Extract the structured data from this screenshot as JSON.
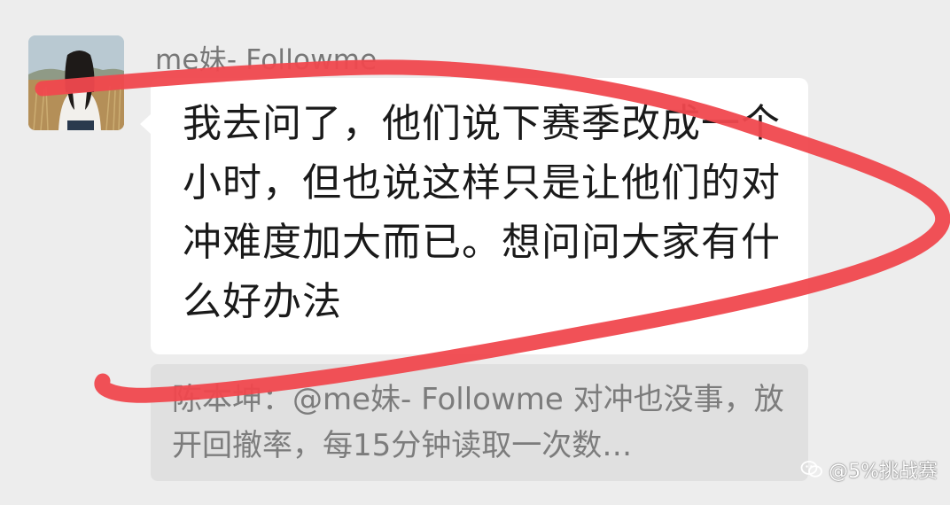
{
  "message": {
    "sender_name": "me妹- Followme",
    "text": "我去问了，他们说下赛季改成一个小时，但也说这样只是让他们的对冲难度加大而已。想问问大家有什么好办法"
  },
  "quoted_reply": {
    "text": "陈本坤：@me妹- Followme 对冲也没事，放开回撤率，每15分钟读取一次数…"
  },
  "avatar": {
    "icon": "user-avatar-photo"
  },
  "watermark": {
    "text": "@5%挑战赛",
    "icon": "wechat-icon"
  },
  "annotation": {
    "color": "#f0484e",
    "icon": "red-marker-loop"
  }
}
